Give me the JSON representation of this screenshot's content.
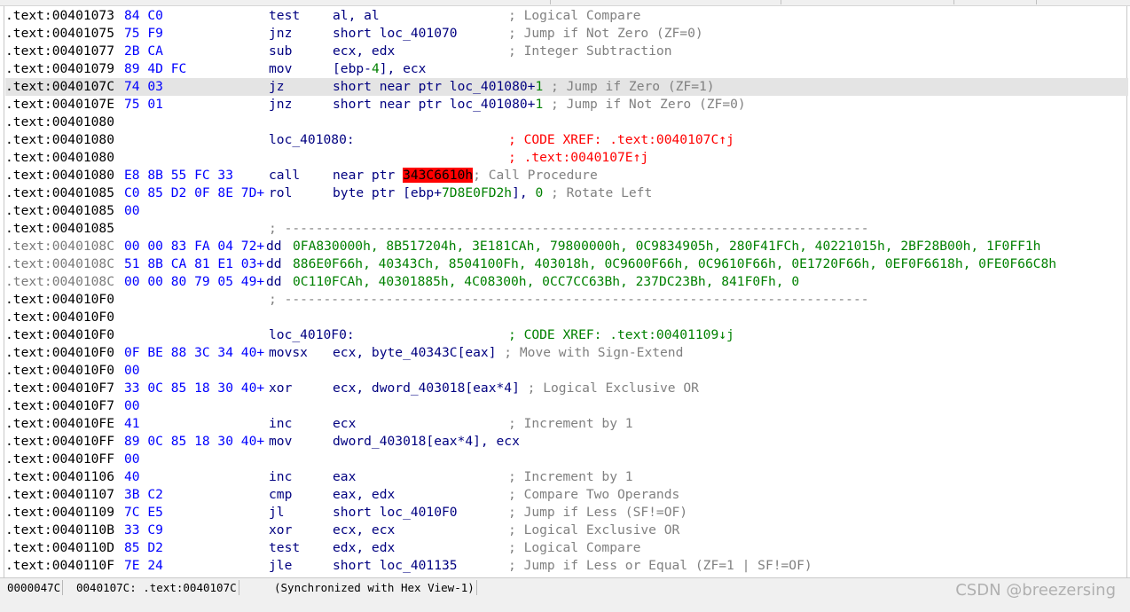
{
  "rows": [
    {
      "addr": ".text:00401073",
      "bytes": "84 C0",
      "mnem": "test",
      "ops": "al, al",
      "cmt": "; Logical Compare"
    },
    {
      "addr": ".text:00401075",
      "bytes": "75 F9",
      "mnem": "jnz",
      "ops": "short loc_401070",
      "cmt": "; Jump if Not Zero (ZF=0)"
    },
    {
      "addr": ".text:00401077",
      "bytes": "2B CA",
      "mnem": "sub",
      "ops": "ecx, edx",
      "cmt": "; Integer Subtraction"
    },
    {
      "addr": ".text:00401079",
      "bytes": "89 4D FC",
      "mnem": "mov",
      "ops_a": "[ebp-",
      "ops_num": "4",
      "ops_b": "], ecx",
      "cmt": ""
    },
    {
      "addr": ".text:0040107C",
      "bytes": "74 03",
      "mnem": "jz",
      "ops_a": "short near ptr loc_401080+",
      "ops_num": "1",
      "ops_b": " ",
      "cmt": "; Jump if Zero (ZF=1)"
    },
    {
      "addr": ".text:0040107E",
      "bytes": "75 01",
      "mnem": "jnz",
      "ops_a": "short near ptr loc_401080+",
      "ops_num": "1",
      "ops_b": " ",
      "cmt": "; Jump if Not Zero (ZF=0)"
    },
    {
      "addr": ".text:00401080"
    },
    {
      "addr": ".text:00401080",
      "label": "loc_401080:",
      "xref": "; CODE XREF: .text:0040107C↑j"
    },
    {
      "addr": ".text:00401080",
      "xref": "; .text:0040107E↑j"
    },
    {
      "addr": ".text:00401080",
      "bytes": "E8 8B 55 FC 33",
      "mnem": "call",
      "ops_a": "near ptr ",
      "ops_bad": "343C6610h",
      "cmt": "; Call Procedure"
    },
    {
      "addr": ".text:00401085",
      "bytes": "C0 85 D2 0F 8E 7D+",
      "mnem": "rol",
      "ops_a": "byte ptr [ebp+",
      "ops_num": "7D8E0FD2h",
      "ops_b": "], ",
      "ops_num2": "0",
      "cmt": " ; Rotate Left"
    },
    {
      "addr": ".text:00401085",
      "bytes": "00"
    },
    {
      "addr": ".text:00401085",
      "sep": "; ---------------------------------------------------------------------------"
    },
    {
      "addr": ".text:0040108C",
      "bytes": "00 00 83 FA 04 72+",
      "mnem": "dd",
      "data": "0FA830000h, 8B517204h, 3E181CAh, 79800000h, 0C9834905h, 280F41FCh, 40221015h, 2BF28B00h, 1F0FF1h"
    },
    {
      "addr": ".text:0040108C",
      "bytes": "51 8B CA 81 E1 03+",
      "mnem": "dd",
      "data": "886E0F66h, 40343Ch, 8504100Fh, 403018h, 0C9600F66h, 0C9610F66h, 0E1720F66h, 0EF0F6618h, 0FE0F66C8h"
    },
    {
      "addr": ".text:0040108C",
      "bytes": "00 00 80 79 05 49+",
      "mnem": "dd",
      "data": "0C110FCAh, 40301885h, 4C08300h, 0CC7CC63Bh, 237DC23Bh, 841F0Fh, 0"
    },
    {
      "addr": ".text:004010F0",
      "sep": "; ---------------------------------------------------------------------------"
    },
    {
      "addr": ".text:004010F0"
    },
    {
      "addr": ".text:004010F0",
      "label": "loc_4010F0:",
      "xref_green": "; CODE XREF: .text:00401109↓j"
    },
    {
      "addr": ".text:004010F0",
      "bytes": "0F BE 88 3C 34 40+",
      "mnem": "movsx",
      "ops": "ecx, byte_40343C[eax]",
      "cmt": " ; Move with Sign-Extend"
    },
    {
      "addr": ".text:004010F0",
      "bytes": "00"
    },
    {
      "addr": ".text:004010F7",
      "bytes": "33 0C 85 18 30 40+",
      "mnem": "xor",
      "ops": "ecx, dword_403018[eax*4]",
      "cmt": " ; Logical Exclusive OR"
    },
    {
      "addr": ".text:004010F7",
      "bytes": "00"
    },
    {
      "addr": ".text:004010FE",
      "bytes": "41",
      "mnem": "inc",
      "ops": "ecx",
      "cmt": "; Increment by 1"
    },
    {
      "addr": ".text:004010FF",
      "bytes": "89 0C 85 18 30 40+",
      "mnem": "mov",
      "ops": "dword_403018[eax*4], ecx",
      "cmt": ""
    },
    {
      "addr": ".text:004010FF",
      "bytes": "00"
    },
    {
      "addr": ".text:00401106",
      "bytes": "40",
      "mnem": "inc",
      "ops": "eax",
      "cmt": "; Increment by 1"
    },
    {
      "addr": ".text:00401107",
      "bytes": "3B C2",
      "mnem": "cmp",
      "ops": "eax, edx",
      "cmt": "; Compare Two Operands"
    },
    {
      "addr": ".text:00401109",
      "bytes": "7C E5",
      "mnem": "jl",
      "ops": "short loc_4010F0",
      "cmt": "; Jump if Less (SF!=OF)"
    },
    {
      "addr": ".text:0040110B",
      "bytes": "33 C9",
      "mnem": "xor",
      "ops": "ecx, ecx",
      "cmt": "; Logical Exclusive OR"
    },
    {
      "addr": ".text:0040110D",
      "bytes": "85 D2",
      "mnem": "test",
      "ops": "edx, edx",
      "cmt": "; Logical Compare"
    },
    {
      "addr": ".text:0040110F",
      "bytes": "7E 24",
      "mnem": "jle",
      "ops": "short loc_401135",
      "cmt": "; Jump if Less or Equal (ZF=1 | SF!=OF)"
    }
  ],
  "highlighted_row": 4,
  "grey_rows": [
    13,
    14,
    15
  ],
  "status": {
    "offset": "0000047C",
    "location": "0040107C: .text:0040107C",
    "sync": "(Synchronized with Hex View-1)"
  },
  "watermark": "CSDN @breezersing",
  "colors": {
    "address": "#000000",
    "bytes": "#0000ff",
    "instruction": "#000080",
    "comment": "#808080",
    "number": "#008000",
    "xref_red": "#ff0000",
    "highlight_row": "#e4e4e4",
    "bad_reference_bg": "#ff0000"
  }
}
